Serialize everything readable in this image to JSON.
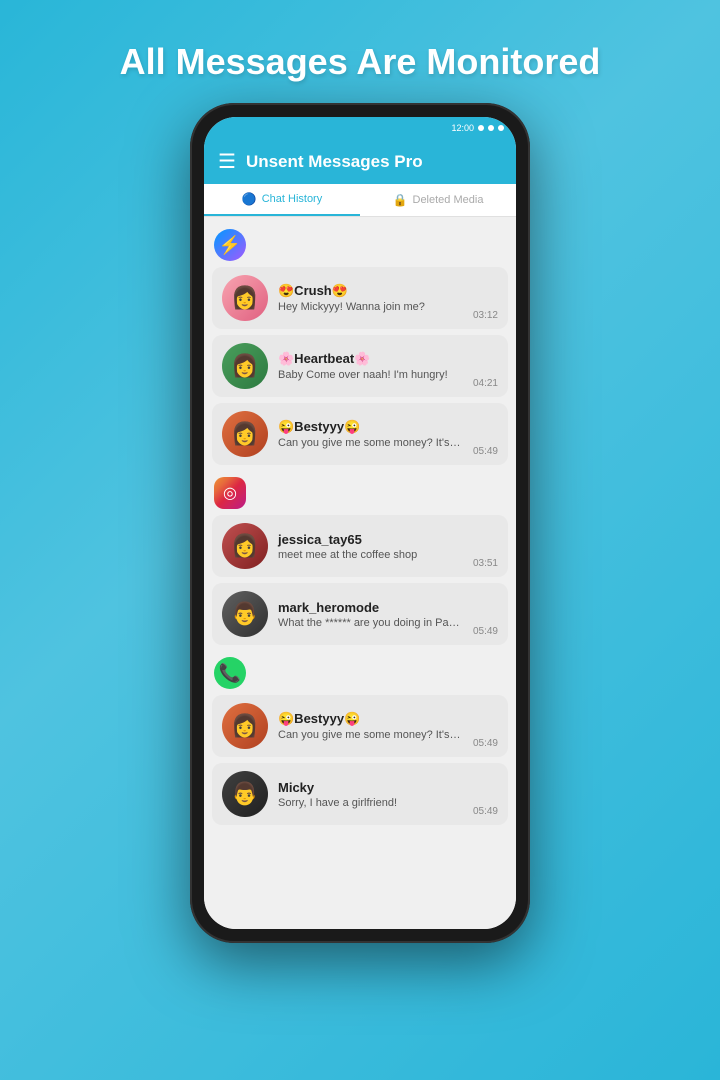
{
  "headline": "All Messages Are Monitored",
  "app": {
    "title": "Unsent Messages Pro",
    "hamburger": "☰"
  },
  "tabs": [
    {
      "id": "chat-history",
      "label": "Chat History",
      "icon": "🔵",
      "active": true
    },
    {
      "id": "deleted-media",
      "label": "Deleted Media",
      "icon": "🔒",
      "active": false
    }
  ],
  "sections": [
    {
      "app": "messenger",
      "icon": "💬",
      "iconType": "messenger",
      "messages": [
        {
          "name": "😍Crush😍",
          "text": "Hey Mickyyy! Wanna join me?",
          "time": "03:12",
          "avatarType": "crush",
          "avatarEmoji": "👩"
        },
        {
          "name": "🌸Heartbeat🌸",
          "text": "Baby Come over naah! I'm hungry!",
          "time": "04:21",
          "avatarType": "heartbeat",
          "avatarEmoji": "👩"
        },
        {
          "name": "😜Bestyyy😜",
          "text": "Can you give me some money? It's urgent",
          "time": "05:49",
          "avatarType": "besty",
          "avatarEmoji": "👩"
        }
      ]
    },
    {
      "app": "instagram",
      "icon": "📷",
      "iconType": "instagram",
      "messages": [
        {
          "name": "jessica_tay65",
          "text": "meet mee at the coffee shop",
          "time": "03:51",
          "avatarType": "jessica",
          "avatarEmoji": "👩"
        },
        {
          "name": "mark_heromode",
          "text": "What the ****** are you doing in Paris!",
          "time": "05:49",
          "avatarType": "mark",
          "avatarEmoji": "👨"
        }
      ]
    },
    {
      "app": "whatsapp",
      "icon": "📱",
      "iconType": "whatsapp",
      "messages": [
        {
          "name": "😜Bestyyy😜",
          "text": "Can you give me some money? It's urgent",
          "time": "05:49",
          "avatarType": "besty2",
          "avatarEmoji": "👩"
        },
        {
          "name": "Micky",
          "text": "Sorry, I have a girlfriend!",
          "time": "05:49",
          "avatarType": "micky",
          "avatarEmoji": "👨"
        }
      ]
    }
  ]
}
